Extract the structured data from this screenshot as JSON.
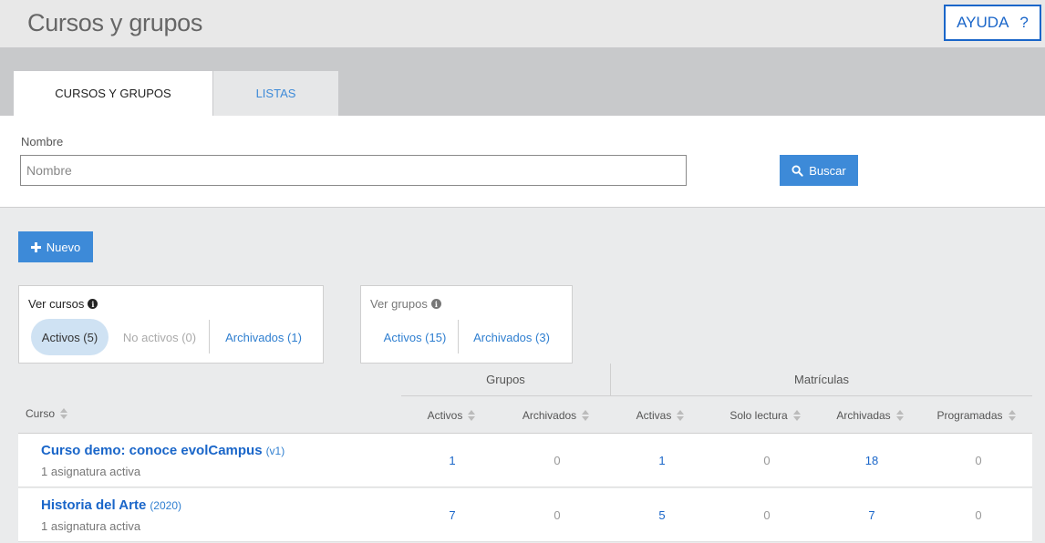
{
  "header": {
    "title": "Cursos y grupos",
    "help_label": "AYUDA",
    "help_icon": "?"
  },
  "tabs": [
    {
      "label": "CURSOS Y GRUPOS",
      "active": true
    },
    {
      "label": "LISTAS",
      "active": false
    }
  ],
  "search": {
    "label": "Nombre",
    "placeholder": "Nombre",
    "value": "",
    "button_label": "Buscar",
    "icon": "search-icon"
  },
  "new_button": {
    "label": "Nuevo",
    "icon": "plus-icon"
  },
  "filters": {
    "courses": {
      "title": "Ver cursos",
      "options": [
        "Activos (5)",
        "No activos (0)",
        "Archivados (1)"
      ],
      "selected": "Activos (5)"
    },
    "groups": {
      "title": "Ver grupos",
      "options": [
        "Activos (15)",
        "Archivados (3)"
      ]
    }
  },
  "table": {
    "group_headers": [
      "Grupos",
      "Matrículas"
    ],
    "course_header": "Curso",
    "columns": [
      "Activos",
      "Archivados",
      "Activas",
      "Solo lectura",
      "Archivadas",
      "Programadas"
    ],
    "rows": [
      {
        "name": "Curso demo: conoce evolCampus",
        "version": "(v1)",
        "subtitle": "1 asignatura activa",
        "values": [
          "1",
          "0",
          "1",
          "0",
          "18",
          "0"
        ]
      },
      {
        "name": "Historia del Arte",
        "version": "(2020)",
        "subtitle": "1 asignatura activa",
        "values": [
          "7",
          "0",
          "5",
          "0",
          "7",
          "0"
        ]
      }
    ]
  },
  "colors": {
    "accent": "#3d8ad8",
    "link": "#1a66c9",
    "selected_pill": "#cfe2f3"
  }
}
